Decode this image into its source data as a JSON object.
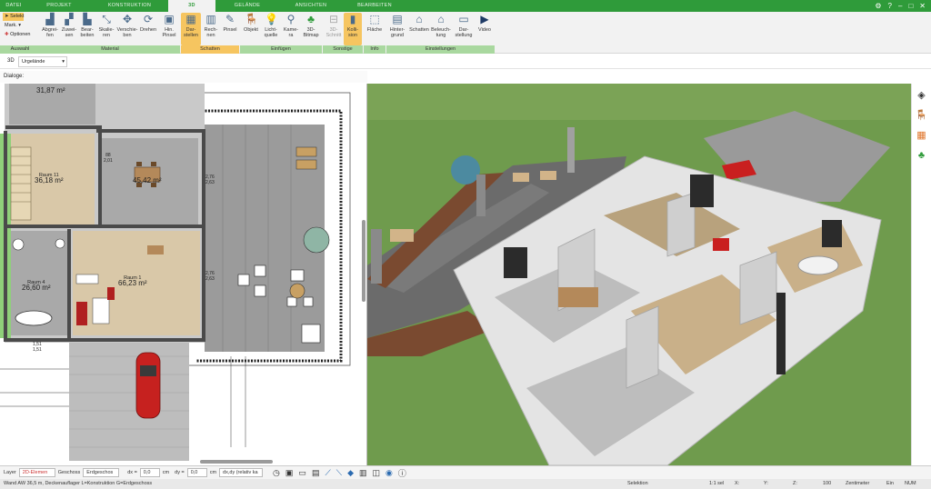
{
  "tabs": [
    {
      "label": "DATEI"
    },
    {
      "label": "PROJEKT"
    },
    {
      "label": "KONSTRUKTION"
    },
    {
      "label": "3D"
    },
    {
      "label": "GELÄNDE"
    },
    {
      "label": "ANSICHTEN"
    },
    {
      "label": "BEARBEITEN"
    }
  ],
  "active_tab": "3D",
  "ribbon": {
    "select": {
      "label": "Selekt",
      "mark": "Mark.",
      "options": "Optionen"
    },
    "buttons": [
      {
        "label": "Abgrei-\nfen"
      },
      {
        "label": "Zuwei-\nsen"
      },
      {
        "label": "Bear-\nbeiten"
      },
      {
        "label": "Skalie-\nren"
      },
      {
        "label": "Verschie-\nben"
      },
      {
        "label": "Drehen"
      },
      {
        "label": "Hin.\nPinsel"
      },
      {
        "label": "Dar-\nstellen"
      },
      {
        "label": "Rech-\nnen"
      },
      {
        "label": "Pinsel"
      },
      {
        "label": "Objekt"
      },
      {
        "label": "Licht-\nquelle"
      },
      {
        "label": "Kame-\nra"
      },
      {
        "label": "3D-\nBitmap"
      },
      {
        "label": "3D-\nSchnitt"
      },
      {
        "label": "Kolli-\nsion"
      },
      {
        "label": "Fläche"
      },
      {
        "label": "Hinter-\ngrund"
      },
      {
        "label": "Schatten"
      },
      {
        "label": "Beleuch-\ntung"
      },
      {
        "label": "Dar-\nstellung"
      },
      {
        "label": "Video"
      }
    ],
    "groups": [
      {
        "label": "Auswahl"
      },
      {
        "label": "Material"
      },
      {
        "label": "Schatten"
      },
      {
        "label": "Einfügen"
      },
      {
        "label": "Sonstige"
      },
      {
        "label": "Info"
      },
      {
        "label": "Einstellungen"
      }
    ]
  },
  "toolbar2": {
    "view_label": "3D",
    "layer_select": "Urgelände"
  },
  "dialog_label": "Dialoge:",
  "plan": {
    "rooms": [
      {
        "name": "",
        "area": "31,87 m²"
      },
      {
        "name": "Raum 11",
        "area": "36,18 m²"
      },
      {
        "name": "",
        "area": "45,42 m²"
      },
      {
        "name": "Raum 1",
        "area": "66,23 m²"
      },
      {
        "name": "Raum 4",
        "area": "26,60 m²"
      }
    ],
    "dims": [
      "2,76",
      "2,63",
      "2,76",
      "2,63",
      "88",
      "2,01",
      "1,51",
      "1,51"
    ]
  },
  "bottombar": {
    "layer_label": "Layer",
    "layer_value": "2D-Elemen",
    "floor_label": "Geschoss",
    "floor_value": "Erdgeschos",
    "dx_label": "dx =",
    "dx_value": "0,0",
    "dy_label": "dy =",
    "dy_value": "0,0",
    "unit": "cm",
    "mode": "dx,dy (relativ ka"
  },
  "status": {
    "left": "Wand AW 36,5 m, Deckenauflager L=Konstruktion G=Erdgeschoss",
    "mode": "Selektion",
    "scale": "1:1 sel",
    "x": "X:",
    "y": "Y:",
    "z": "Z:",
    "zoom": "100",
    "unit": "Zentimeter",
    "ein": "Ein",
    "num": "NUM"
  },
  "colors": {
    "accent": "#2f9b3a",
    "active": "#f6c560",
    "grass": "#6f9b4d"
  }
}
